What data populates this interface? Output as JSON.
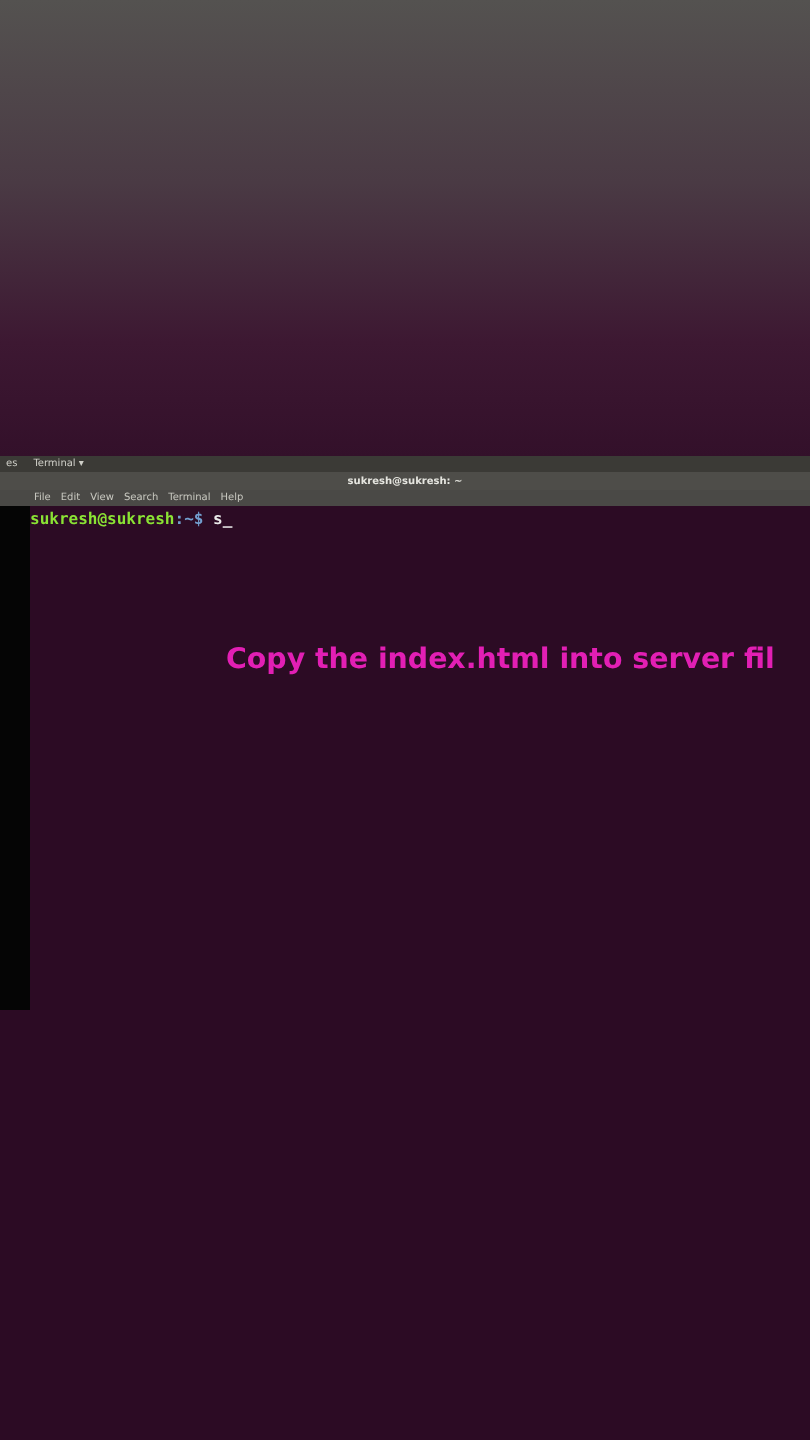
{
  "top_panel": {
    "activities": "es",
    "app_menu": "Terminal ▾"
  },
  "window": {
    "title": "sukresh@sukresh: ~"
  },
  "menu": [
    "File",
    "Edit",
    "View",
    "Search",
    "Terminal",
    "Help"
  ],
  "terminal": {
    "user_host": "sukresh@sukresh",
    "path": ":~$",
    "typed": "s_"
  },
  "caption": "Copy the index.html into server fil"
}
